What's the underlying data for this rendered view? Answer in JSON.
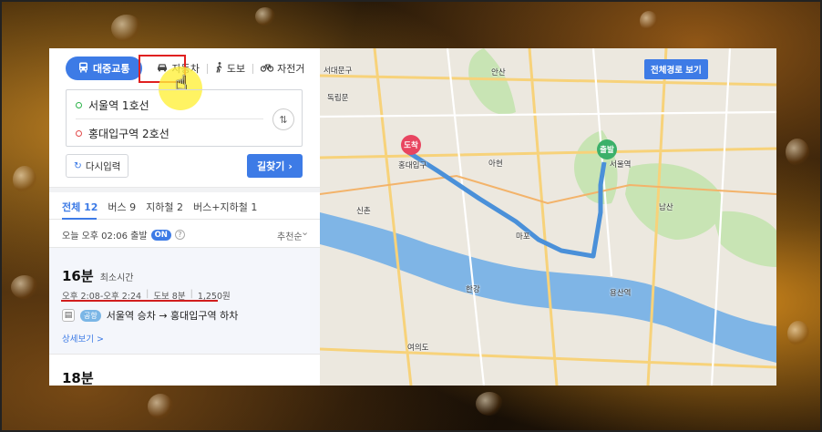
{
  "transport_tabs": [
    {
      "label": "대중교통",
      "icon": "bus-icon",
      "active": true
    },
    {
      "label": "자동차",
      "icon": "car-icon",
      "active": false
    },
    {
      "label": "도보",
      "icon": "walk-icon",
      "active": false
    },
    {
      "label": "자전거",
      "icon": "bicycle-icon",
      "active": false
    }
  ],
  "route": {
    "origin": "서울역 1호선",
    "destination": "홍대입구역 2호선",
    "swap_icon": "swap-icon"
  },
  "actions": {
    "reset_label": "다시입력",
    "search_label": "길찾기"
  },
  "result_tabs": [
    {
      "label": "전체 12",
      "active": true
    },
    {
      "label": "버스 9",
      "active": false
    },
    {
      "label": "지하철 2",
      "active": false
    },
    {
      "label": "버스+지하철 1",
      "active": false
    }
  ],
  "departure": {
    "text": "오늘 오후 02:06 출발",
    "toggle": "ON",
    "sort": "추천순"
  },
  "results": [
    {
      "duration": "16분",
      "badge": "최소시간",
      "time_range": "오후 2:08-오후 2:24",
      "walk": "도보 8분",
      "fare": "1,250원",
      "line_badge": "공항",
      "leg_text": "서울역 승차 → 홍대입구역 하차",
      "detail_link": "상세보기 >"
    },
    {
      "duration": "18분"
    }
  ],
  "map": {
    "full_route_button": "전체경로 보기",
    "start_pin": "출발",
    "end_pin": "도착",
    "start_label": "서울역",
    "end_label": "홍대입구",
    "labels": [
      "서대문구",
      "독립문",
      "신촌",
      "아현",
      "마포",
      "여의도",
      "남산",
      "안산",
      "용산역",
      "한강"
    ],
    "accent_colors": {
      "brand": "#3d7be6",
      "route": "#4a90d9",
      "river": "#7fb5e6",
      "park": "#c8e4b4"
    }
  }
}
